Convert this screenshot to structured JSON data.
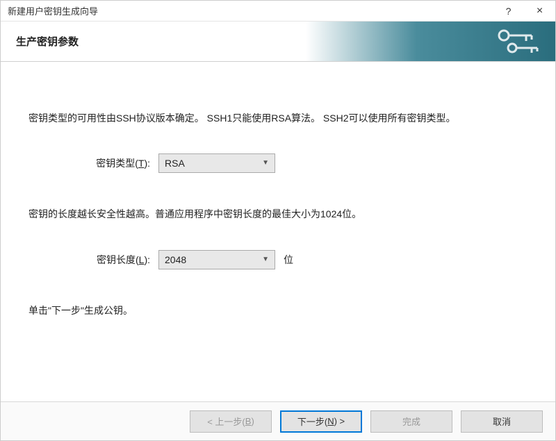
{
  "titlebar": {
    "title": "新建用户密钥生成向导",
    "help": "?",
    "close": "×"
  },
  "header": {
    "title": "生产密钥参数"
  },
  "content": {
    "type_description": "密钥类型的可用性由SSH协议版本确定。 SSH1只能使用RSA算法。 SSH2可以使用所有密钥类型。",
    "type_label_prefix": "密钥类型(",
    "type_label_key": "T",
    "type_label_suffix": "):",
    "type_value": "RSA",
    "length_description": "密钥的长度越长安全性越高。普通应用程序中密钥长度的最佳大小为1024位。",
    "length_label_prefix": "密钥长度(",
    "length_label_key": "L",
    "length_label_suffix": "):",
    "length_value": "2048",
    "length_unit": "位",
    "hint": "单击\"下一步\"生成公钥。"
  },
  "buttons": {
    "back_prefix": "< 上一步(",
    "back_key": "B",
    "back_suffix": ")",
    "next_prefix": "下一步(",
    "next_key": "N",
    "next_suffix": ") >",
    "finish": "完成",
    "cancel": "取消"
  }
}
